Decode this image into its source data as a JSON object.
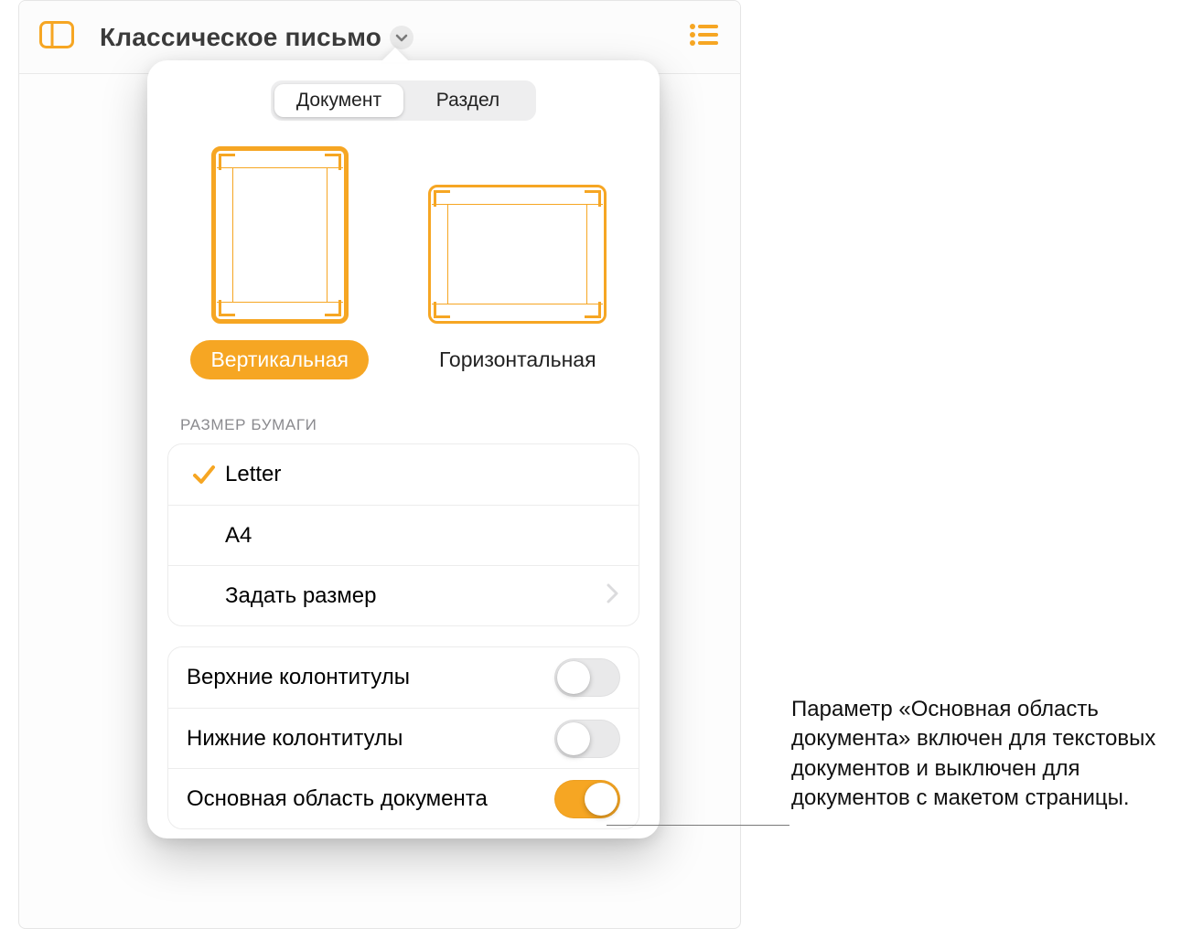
{
  "header": {
    "title": "Классическое письмо"
  },
  "panel": {
    "tabs": {
      "document": "Документ",
      "section": "Раздел"
    },
    "orientation": {
      "portrait": "Вертикальная",
      "landscape": "Горизонтальная",
      "selected": "portrait"
    },
    "paper": {
      "section_label": "РАЗМЕР БУМАГИ",
      "options": [
        {
          "label": "Letter",
          "selected": true
        },
        {
          "label": "A4",
          "selected": false
        }
      ],
      "custom": "Задать размер"
    },
    "toggles": {
      "headers": {
        "label": "Верхние колонтитулы",
        "on": false
      },
      "footers": {
        "label": "Нижние колонтитулы",
        "on": false
      },
      "body": {
        "label": "Основная область документа",
        "on": true
      }
    }
  },
  "annotation": "Параметр «Основная область документа» включен для текстовых документов и выключен для документов с макетом страницы."
}
